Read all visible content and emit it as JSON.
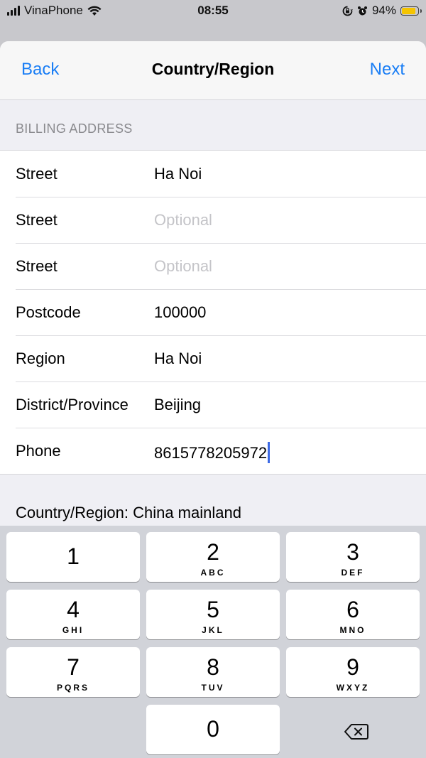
{
  "status_bar": {
    "carrier": "VinaPhone",
    "time": "08:55",
    "battery_percent": "94%",
    "battery_level": 0.94,
    "icons": [
      "signal-icon",
      "wifi-icon",
      "orientation-lock-icon",
      "alarm-icon",
      "battery-icon"
    ]
  },
  "nav": {
    "back_label": "Back",
    "title": "Country/Region",
    "next_label": "Next"
  },
  "form": {
    "section_header": "BILLING ADDRESS",
    "rows": [
      {
        "label": "Street",
        "value": "Ha Noi",
        "placeholder": ""
      },
      {
        "label": "Street",
        "value": "",
        "placeholder": "Optional"
      },
      {
        "label": "Street",
        "value": "",
        "placeholder": "Optional"
      },
      {
        "label": "Postcode",
        "value": "100000",
        "placeholder": ""
      },
      {
        "label": "Region",
        "value": "Ha Noi",
        "placeholder": ""
      },
      {
        "label": "District/Province",
        "value": "Beijing",
        "placeholder": ""
      },
      {
        "label": "Phone",
        "value": "8615778205972",
        "placeholder": ""
      }
    ],
    "country_line": "Country/Region: China mainland"
  },
  "keypad": {
    "keys": [
      {
        "num": "1",
        "letters": ""
      },
      {
        "num": "2",
        "letters": "ABC"
      },
      {
        "num": "3",
        "letters": "DEF"
      },
      {
        "num": "4",
        "letters": "GHI"
      },
      {
        "num": "5",
        "letters": "JKL"
      },
      {
        "num": "6",
        "letters": "MNO"
      },
      {
        "num": "7",
        "letters": "PQRS"
      },
      {
        "num": "8",
        "letters": "TUV"
      },
      {
        "num": "9",
        "letters": "WXYZ"
      },
      {
        "num": "0",
        "letters": ""
      }
    ],
    "delete_icon": "backspace-icon"
  },
  "colors": {
    "accent": "#1a7ef5",
    "caret": "#3d6ae5",
    "battery": "#f5c400"
  }
}
